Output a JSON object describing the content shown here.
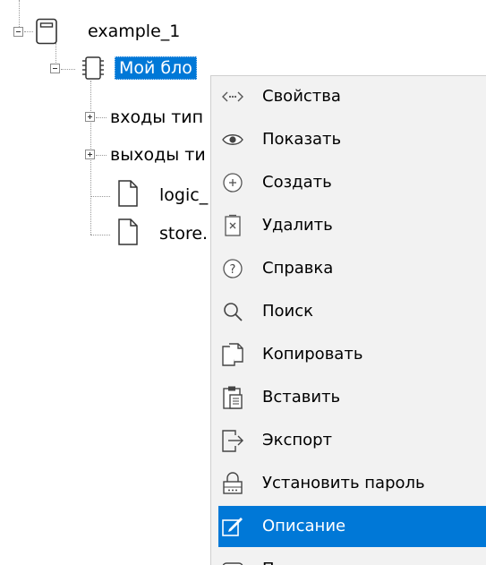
{
  "tree": {
    "root": {
      "label": "example_1",
      "icon": "device-icon"
    },
    "block": {
      "label": "Мой бло",
      "icon": "chip-icon"
    },
    "children": [
      {
        "label": "входы тип",
        "expander": "plus"
      },
      {
        "label": "выходы ти",
        "expander": "plus"
      },
      {
        "label": "logic_",
        "icon": "file-icon"
      },
      {
        "label": "store.",
        "icon": "file-icon"
      }
    ]
  },
  "context_menu": {
    "items": [
      {
        "label": "Свойства",
        "icon": "properties-icon"
      },
      {
        "label": "Показать",
        "icon": "eye-icon"
      },
      {
        "label": "Создать",
        "icon": "add-circle-icon"
      },
      {
        "label": "Удалить",
        "icon": "delete-icon"
      },
      {
        "label": "Справка",
        "icon": "help-icon"
      },
      {
        "label": "Поиск",
        "icon": "search-icon"
      },
      {
        "label": "Копировать",
        "icon": "copy-icon"
      },
      {
        "label": "Вставить",
        "icon": "paste-icon"
      },
      {
        "label": "Экспорт",
        "icon": "export-icon"
      },
      {
        "label": "Установить пароль",
        "icon": "lock-icon"
      },
      {
        "label": "Описание",
        "icon": "edit-icon",
        "highlighted": true
      },
      {
        "label": "П",
        "icon": "item-icon"
      }
    ]
  },
  "colors": {
    "highlight": "#0078d7",
    "menu_bg": "#f2f2f2",
    "text": "#000000"
  }
}
